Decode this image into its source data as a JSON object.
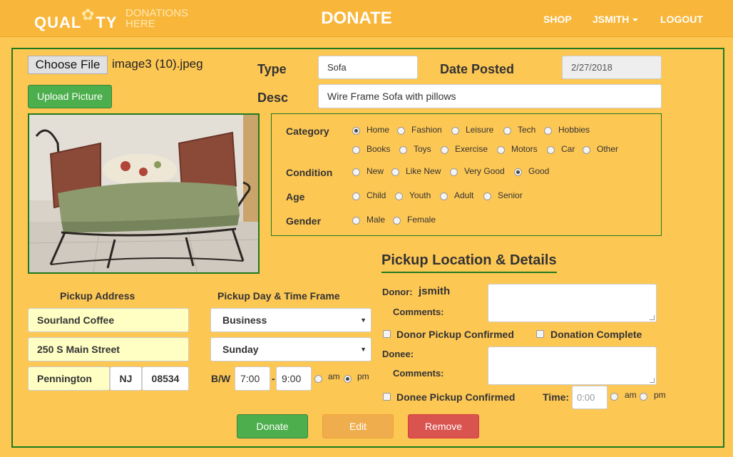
{
  "nav": {
    "logo_main_left": "QUAL",
    "logo_main_right": "TY",
    "logo_sub": "DONATIONS HERE",
    "title": "DONATE",
    "shop": "SHOP",
    "user": "JSMITH",
    "logout": "LOGOUT"
  },
  "upload": {
    "choose_file": "Choose File",
    "file_name": "image3 (10).jpeg",
    "upload_button": "Upload Picture"
  },
  "item": {
    "type_label": "Type",
    "type_value": "Sofa",
    "date_label": "Date Posted",
    "date_value": "2/27/2018",
    "desc_label": "Desc",
    "desc_value": "Wire Frame Sofa with pillows"
  },
  "category": {
    "label": "Category",
    "options": [
      "Home",
      "Fashion",
      "Leisure",
      "Tech",
      "Hobbies",
      "Books",
      "Toys",
      "Exercise",
      "Motors",
      "Car",
      "Other"
    ],
    "selected": "Home"
  },
  "condition": {
    "label": "Condition",
    "options": [
      "New",
      "Like New",
      "Very Good",
      "Good"
    ],
    "selected": "Good"
  },
  "age": {
    "label": "Age",
    "options": [
      "Child",
      "Youth",
      "Adult",
      "Senior"
    ],
    "selected": ""
  },
  "gender": {
    "label": "Gender",
    "options": [
      "Male",
      "Female"
    ],
    "selected": ""
  },
  "address": {
    "label": "Pickup Address",
    "name": "Sourland Coffee",
    "street": "250 S Main Street",
    "city": "Pennington",
    "state": "NJ",
    "zip": "08534"
  },
  "timeframe": {
    "label": "Pickup Day & Time Frame",
    "day_type": "Business",
    "day": "Sunday",
    "bw_label": "B/W",
    "from": "7:00",
    "dash": "-",
    "to": "9:00",
    "am": "am",
    "pm": "pm",
    "selected_period": "pm"
  },
  "pickup": {
    "title": "Pickup Location & Details",
    "donor_label": "Donor:",
    "donor_name": "jsmith",
    "comments_label": "Comments:",
    "donor_confirmed": "Donor Pickup Confirmed",
    "donation_complete": "Donation Complete",
    "donee_label": "Donee:",
    "donee_comments_label": "Comments:",
    "donee_confirmed": "Donee Pickup Confirmed",
    "time_label": "Time:",
    "time_placeholder": "0:00",
    "am": "am",
    "pm": "pm"
  },
  "actions": {
    "donate": "Donate",
    "edit": "Edit",
    "remove": "Remove"
  },
  "colors": {
    "navbar": "#f8b63a",
    "background": "#fdc754",
    "frame": "#1f7a1f",
    "donate": "#4cae4c",
    "edit": "#f0ad4e",
    "remove": "#d9534f"
  }
}
